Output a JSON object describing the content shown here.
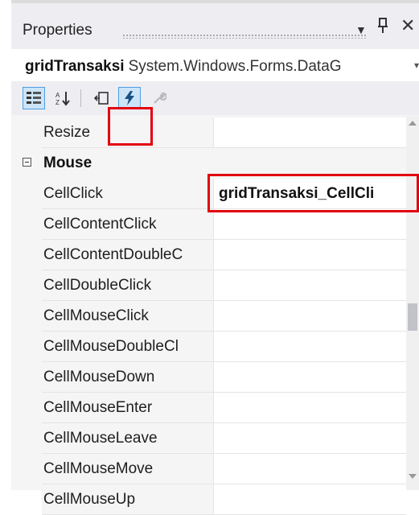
{
  "titlebar": {
    "title": "Properties",
    "dropdown_icon": "caret-down-icon",
    "pin_icon": "pin-icon",
    "close_icon": "close-icon",
    "dropdown_glyph": "▼",
    "pin_glyph": "ᚚ",
    "close_glyph": "✕"
  },
  "object_selector": {
    "name": "gridTransaksi",
    "type": "System.Windows.Forms.DataG",
    "arrow": "▾"
  },
  "toolbar": {
    "categorized_icon": "▦",
    "alphabetical_icon": "↧",
    "properties_icon": "⎘",
    "events_icon": "⚡",
    "property_pages_icon": "🔧"
  },
  "grid": {
    "rows": [
      {
        "type": "prop",
        "name": "Resize",
        "value": ""
      },
      {
        "type": "category",
        "name": "Mouse"
      },
      {
        "type": "prop",
        "name": "CellClick",
        "value": "gridTransaksi_CellCli",
        "bold": true
      },
      {
        "type": "prop",
        "name": "CellContentClick",
        "value": ""
      },
      {
        "type": "prop",
        "name": "CellContentDoubleC",
        "value": ""
      },
      {
        "type": "prop",
        "name": "CellDoubleClick",
        "value": ""
      },
      {
        "type": "prop",
        "name": "CellMouseClick",
        "value": ""
      },
      {
        "type": "prop",
        "name": "CellMouseDoubleCl",
        "value": ""
      },
      {
        "type": "prop",
        "name": "CellMouseDown",
        "value": ""
      },
      {
        "type": "prop",
        "name": "CellMouseEnter",
        "value": ""
      },
      {
        "type": "prop",
        "name": "CellMouseLeave",
        "value": ""
      },
      {
        "type": "prop",
        "name": "CellMouseMove",
        "value": ""
      },
      {
        "type": "prop",
        "name": "CellMouseUp",
        "value": ""
      }
    ],
    "scroll_position": 0.55
  },
  "colors": {
    "highlight": "#e3000f",
    "selected_tool_bg": "#cce4f7"
  }
}
